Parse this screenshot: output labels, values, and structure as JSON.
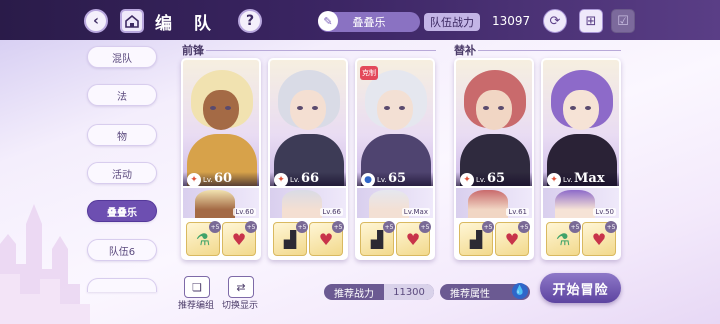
{
  "header": {
    "title": "编 队",
    "team_name": "叠叠乐",
    "power_label": "队伍战力",
    "power_value": "13097"
  },
  "sidebar": {
    "items": [
      {
        "label": "混队",
        "active": false
      },
      {
        "label": "法",
        "active": false
      },
      {
        "label": "物",
        "active": false
      },
      {
        "label": "活动",
        "active": false
      },
      {
        "label": "叠叠乐",
        "active": true
      },
      {
        "label": "队伍6",
        "active": false
      }
    ]
  },
  "sections": {
    "vanguard": "前锋",
    "substitute": "替补"
  },
  "cards": [
    {
      "lv_prefix": "Lv.",
      "level": "60",
      "element_icon": "fire-icon",
      "element_color": "#e0533a",
      "support_lv": "Lv.60",
      "restrain": "",
      "hair": "#f1e2b0",
      "skin": "#a46a45",
      "outfit": "#d7a24a",
      "equip": [
        "green-potion-icon",
        "heart-gem-icon"
      ],
      "badges": [
        "+5",
        "+5"
      ]
    },
    {
      "lv_prefix": "Lv.",
      "level": "66",
      "element_icon": "fire-icon",
      "element_color": "#e0533a",
      "support_lv": "Lv.66",
      "restrain": "",
      "hair": "#d9dbe6",
      "skin": "#f4dfd2",
      "outfit": "#3d3b56",
      "equip": [
        "boot-icon",
        "heart-gem-icon"
      ],
      "badges": [
        "+5",
        "+5"
      ]
    },
    {
      "lv_prefix": "Lv.",
      "level": "65",
      "element_icon": "water-icon",
      "element_color": "#2f66c9",
      "support_lv": "Lv.Max",
      "restrain": "克制",
      "hair": "#e5e7ef",
      "skin": "#f3e0d4",
      "outfit": "#4f4470",
      "equip": [
        "boot-icon",
        "heart-gem-icon"
      ],
      "badges": [
        "+5",
        "+5"
      ]
    },
    {
      "lv_prefix": "Lv.",
      "level": "65",
      "element_icon": "fire-icon",
      "element_color": "#e0533a",
      "support_lv": "Lv.61",
      "restrain": "",
      "hair": "#c96a6c",
      "skin": "#f1d6c4",
      "outfit": "#2f2a3e",
      "equip": [
        "boot-icon",
        "heart-gem-icon"
      ],
      "badges": [
        "+5",
        "+5"
      ]
    },
    {
      "lv_prefix": "Lv.",
      "level": "Max",
      "element_icon": "fire-icon",
      "element_color": "#e0533a",
      "support_lv": "Lv.50",
      "restrain": "",
      "hair": "#8d6ac9",
      "skin": "#f6e3d6",
      "outfit": "#2a2236",
      "equip": [
        "green-potion-icon",
        "heart-gem-icon"
      ],
      "badges": [
        "+5",
        "+5"
      ]
    }
  ],
  "bottom": {
    "recommend_team": "推荐编组",
    "switch_display": "切换显示",
    "recommend_power_label": "推荐战力",
    "recommend_power_value": "11300",
    "recommend_attr_label": "推荐属性",
    "start_label": "开始冒险"
  },
  "colors": {
    "accent": "#6d4fb1",
    "header_bg": "#2a1b49",
    "fire": "#e0533a",
    "water": "#2f66c9"
  }
}
